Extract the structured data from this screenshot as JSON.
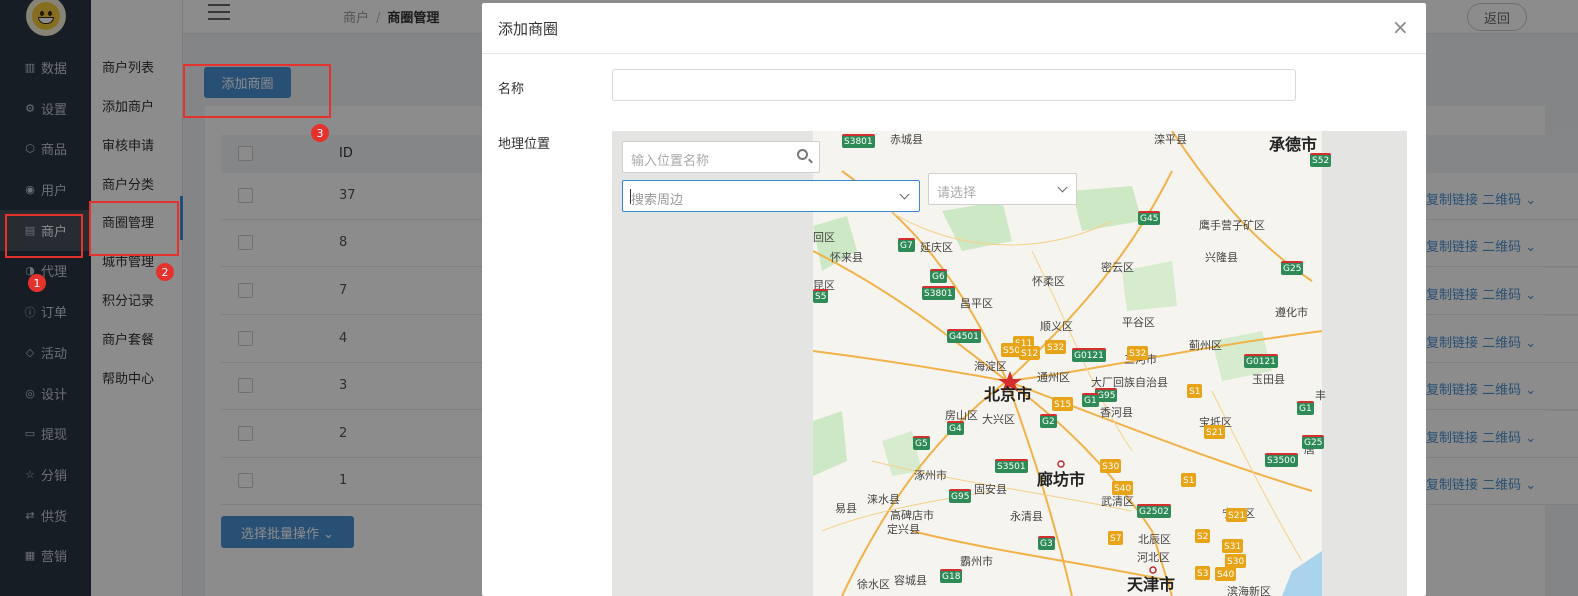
{
  "nav": {
    "items": [
      {
        "label": "数据",
        "icon": "bar-chart-icon"
      },
      {
        "label": "设置",
        "icon": "gear-icon"
      },
      {
        "label": "商品",
        "icon": "box-icon"
      },
      {
        "label": "用户",
        "icon": "user-icon"
      },
      {
        "label": "商户",
        "icon": "store-icon",
        "active": true
      },
      {
        "label": "代理",
        "icon": "agent-icon"
      },
      {
        "label": "订单",
        "icon": "order-icon"
      },
      {
        "label": "活动",
        "icon": "tag-icon"
      },
      {
        "label": "设计",
        "icon": "palette-icon"
      },
      {
        "label": "提现",
        "icon": "wallet-icon"
      },
      {
        "label": "分销",
        "icon": "star-icon"
      },
      {
        "label": "供货",
        "icon": "swap-icon"
      },
      {
        "label": "营销",
        "icon": "grid-icon"
      }
    ]
  },
  "subnav": {
    "items": [
      "商户列表",
      "添加商户",
      "审核申请",
      "商户分类",
      "商圈管理",
      "城市管理",
      "积分记录",
      "商户套餐",
      "帮助中心"
    ],
    "active": "商圈管理"
  },
  "header": {
    "breadcrumb_parent": "商户",
    "breadcrumb_sep": "/",
    "breadcrumb_current": "商圈管理",
    "back_label": "返回"
  },
  "toolbar": {
    "add_label": "添加商圈"
  },
  "table": {
    "id_header": "ID",
    "rows": [
      {
        "id": "37",
        "links": "复制链接 二维码 ⌄"
      },
      {
        "id": "8",
        "links": "复制链接 二维码 ⌄"
      },
      {
        "id": "7",
        "links": "复制链接 二维码 ⌄"
      },
      {
        "id": "4",
        "links": "复制链接 二维码 ⌄"
      },
      {
        "id": "3",
        "links": "复制链接 二维码 ⌄"
      },
      {
        "id": "2",
        "links": "复制链接 二维码 ⌄"
      },
      {
        "id": "1",
        "links": "复制链接 二维码 ⌄"
      }
    ],
    "batch_label": "选择批量操作 ⌄"
  },
  "annotations": [
    "1",
    "2",
    "3"
  ],
  "modal": {
    "title": "添加商圈",
    "close": "×",
    "name_label": "名称",
    "name_value": "",
    "geo_label": "地理位置",
    "search_placeholder": "输入位置名称",
    "nearby_placeholder": "搜索周边",
    "select_placeholder": "请选择"
  },
  "map": {
    "cities": [
      "北京市",
      "廊坊市",
      "天津市",
      "承德市"
    ],
    "districts": [
      "赤城县",
      "滦平县",
      "鹰手营子矿区",
      "兴隆县",
      "延庆区",
      "怀来县",
      "密云区",
      "怀柔区",
      "昌平区",
      "遵化市",
      "平谷区",
      "顺义区",
      "蓟州区",
      "三河市",
      "海淀区",
      "通州区",
      "玉田县",
      "大厂回族自治县",
      "香河县",
      "宝坻区",
      "房山区",
      "大兴区",
      "涿州市",
      "固安县",
      "武清区",
      "涞水县",
      "高碑店市",
      "永清县",
      "宁河区",
      "定兴县",
      "易县",
      "霸州市",
      "北辰区",
      "河北区",
      "徐水区",
      "容城县",
      "滨海新区",
      "唐",
      "丰",
      "回区",
      "昆区"
    ],
    "roads": [
      "S3801",
      "S52",
      "G45",
      "G7",
      "G25",
      "G6",
      "S3801",
      "G4501",
      "S11",
      "S50",
      "S12",
      "S32",
      "S32",
      "G0121",
      "G0121",
      "G95",
      "G1",
      "S15",
      "S1",
      "G1",
      "G4",
      "G2",
      "G5",
      "S21",
      "G25",
      "S3501",
      "S30",
      "S3500",
      "S40",
      "G95",
      "S1",
      "G2502",
      "S21",
      "S7",
      "S2",
      "S31",
      "G3",
      "G18",
      "S30",
      "S3",
      "S40",
      "S5"
    ]
  }
}
